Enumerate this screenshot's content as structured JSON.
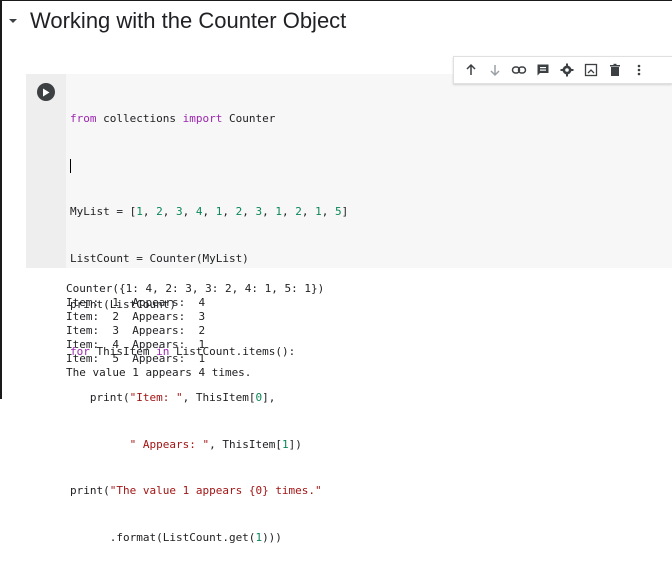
{
  "section": {
    "title": "Working with the Counter Object"
  },
  "toolbar": {
    "icons": [
      "arrow-up-icon",
      "arrow-down-icon",
      "link-icon",
      "comment-icon",
      "settings-icon",
      "mirror-cell-icon",
      "delete-icon",
      "more-icon"
    ]
  },
  "code": {
    "line1": {
      "kw1": "from",
      "mod": " collections ",
      "kw2": "import",
      "name": " Counter"
    },
    "line3": {
      "pre": "MyList = [",
      "nums": [
        "1",
        "2",
        "3",
        "4",
        "1",
        "2",
        "3",
        "1",
        "2",
        "1",
        "5"
      ],
      "post": "]"
    },
    "line4": "ListCount = Counter(MyList)",
    "line5": "print(ListCount)",
    "line6": {
      "kw1": "for",
      "mid": " ThisItem ",
      "kw2": "in",
      "post": " ListCount.items():"
    },
    "line7": {
      "pre": "   print(",
      "str": "\"Item: \"",
      "mid": ", ThisItem[",
      "num": "0",
      "post": "],"
    },
    "line8": {
      "pre": "         ",
      "str": "\" Appears: \"",
      "mid": ", ThisItem[",
      "num": "1",
      "post": "])"
    },
    "line9": {
      "pre": "print(",
      "str": "\"The value 1 appears {0} times.\""
    },
    "line10": {
      "pre": "      .format(ListCount.get(",
      "num": "1",
      "post": ")))"
    }
  },
  "output": {
    "lines": [
      "Counter({1: 4, 2: 3, 3: 2, 4: 1, 5: 1})",
      "Item:  1  Appears:  4",
      "Item:  2  Appears:  3",
      "Item:  3  Appears:  2",
      "Item:  4  Appears:  1",
      "Item:  5  Appears:  1",
      "The value 1 appears 4 times."
    ]
  },
  "colors": {
    "keyword": "#9c27b0",
    "string": "#a31515",
    "number": "#098658",
    "gutter": "#eeeeee",
    "code_bg": "#f7f7f7"
  }
}
